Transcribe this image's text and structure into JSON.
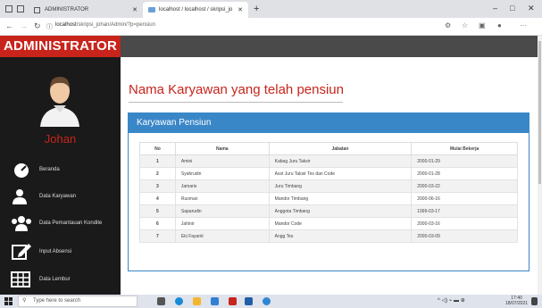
{
  "browser": {
    "tabs": [
      {
        "label": "ADMINISTRATOR"
      },
      {
        "label": "localhost / localhost / skripsi_jo"
      }
    ],
    "new_tab": "+",
    "url_host": "localhost",
    "url_path": "/skripsi_johan/Admin/?p=pensiun",
    "window_controls": {
      "minimize": "–",
      "maximize": "□",
      "close": "✕"
    }
  },
  "sidebar": {
    "brand": "ADMINISTRATOR",
    "user_name": "Johan",
    "items": [
      {
        "label": "Beranda",
        "icon": "dashboard-icon"
      },
      {
        "label": "Data Karyawan",
        "icon": "user-icon"
      },
      {
        "label": "Data Pemantauan Kondite",
        "icon": "users-icon"
      },
      {
        "label": "Input Absensi",
        "icon": "edit-icon"
      },
      {
        "label": "Data Lembur",
        "icon": "table-icon"
      }
    ]
  },
  "main": {
    "page_title": "Nama Karyawan yang telah pensiun",
    "panel_title": "Karyawan Pensiun",
    "table": {
      "headers": [
        "No",
        "Nama",
        "Jabatan",
        "Mulai Bekerja"
      ],
      "rows": [
        [
          "1",
          "Amini",
          "Kabag Juru Taksir",
          "2000-01-29"
        ],
        [
          "2",
          "Syahrudin",
          "Asst Juru Taksir Tes dan Code",
          "2000-01-28"
        ],
        [
          "3",
          "Jamaris",
          "Juru Timbang",
          "2000-03-22"
        ],
        [
          "4",
          "Rusman",
          "Mandor Timbang",
          "2000-06-16"
        ],
        [
          "5",
          "Saparudin",
          "Anggota Timbang",
          "1999-03-17"
        ],
        [
          "6",
          "Jahinir",
          "Mandor Code",
          "2000-03-16"
        ],
        [
          "7",
          "Eki Fayanti",
          "Angg Tes",
          "2000-03-09"
        ]
      ]
    }
  },
  "taskbar": {
    "search_placeholder": "Type here to search",
    "time": "17:40",
    "date": "18/07/2021"
  },
  "colors": {
    "brand_red": "#c8241c",
    "panel_blue": "#3a87c8",
    "sidebar_bg": "#1a1a1a"
  }
}
